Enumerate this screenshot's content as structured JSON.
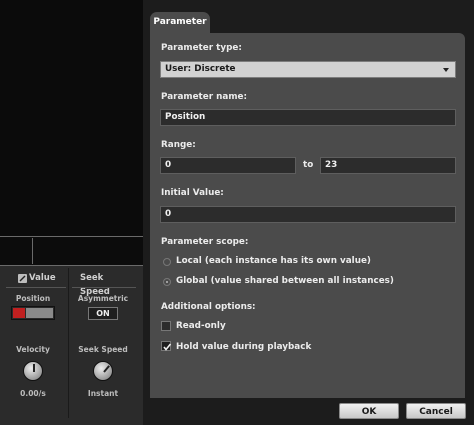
{
  "background": {
    "value_header": "Value",
    "seek_header": "Seek Speed",
    "position_label": "Position",
    "asymmetric_label": "Asymmetric",
    "asymmetric_toggle": "ON",
    "velocity_label": "Velocity",
    "velocity_value": "0.00/s",
    "seek_speed_label": "Seek Speed",
    "seek_speed_value": "Instant"
  },
  "dialog": {
    "tab_label": "Parameter",
    "type_label": "Parameter type:",
    "type_value": "User: Discrete",
    "name_label": "Parameter name:",
    "name_value": "Position",
    "range_label": "Range:",
    "range_min": "0",
    "range_to": "to",
    "range_max": "23",
    "initial_label": "Initial Value:",
    "initial_value": "0",
    "scope_label": "Parameter scope:",
    "scope_local": "Local (each instance has its own value)",
    "scope_global": "Global (value shared between all instances)",
    "scope_selected": "global",
    "additional_label": "Additional options:",
    "readonly_label": "Read-only",
    "readonly_checked": false,
    "hold_label": "Hold value during playback",
    "hold_checked": true,
    "ok_label": "OK",
    "cancel_label": "Cancel"
  },
  "colors": {
    "panel": "#4b4b4b",
    "field": "#2c2c2c",
    "indicator_red": "#c02020"
  }
}
